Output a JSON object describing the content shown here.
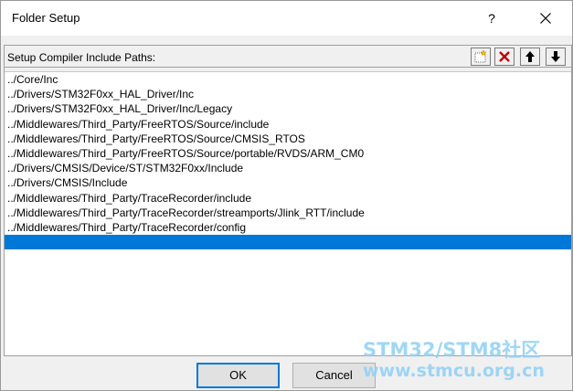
{
  "window": {
    "title": "Folder Setup",
    "help_label": "?"
  },
  "panel": {
    "label": "Setup Compiler Include Paths:",
    "toolbar": [
      {
        "name": "new-folder-icon"
      },
      {
        "name": "delete-icon"
      },
      {
        "name": "move-up-icon"
      },
      {
        "name": "move-down-icon"
      }
    ]
  },
  "paths": [
    "../Core/Inc",
    "../Drivers/STM32F0xx_HAL_Driver/Inc",
    "../Drivers/STM32F0xx_HAL_Driver/Inc/Legacy",
    "../Middlewares/Third_Party/FreeRTOS/Source/include",
    "../Middlewares/Third_Party/FreeRTOS/Source/CMSIS_RTOS",
    "../Middlewares/Third_Party/FreeRTOS/Source/portable/RVDS/ARM_CM0",
    "../Drivers/CMSIS/Device/ST/STM32F0xx/Include",
    "../Drivers/CMSIS/Include",
    "../Middlewares/Third_Party/TraceRecorder/include",
    "../Middlewares/Third_Party/TraceRecorder/streamports/Jlink_RTT/include",
    "../Middlewares/Third_Party/TraceRecorder/config",
    ""
  ],
  "selected_index": 11,
  "buttons": {
    "ok": "OK",
    "cancel": "Cancel"
  },
  "watermark": {
    "line1": "STM32/STM8社区",
    "line2": "www.stmcu.org.cn"
  },
  "colors": {
    "selection": "#0078d7",
    "delete": "#c00000"
  }
}
